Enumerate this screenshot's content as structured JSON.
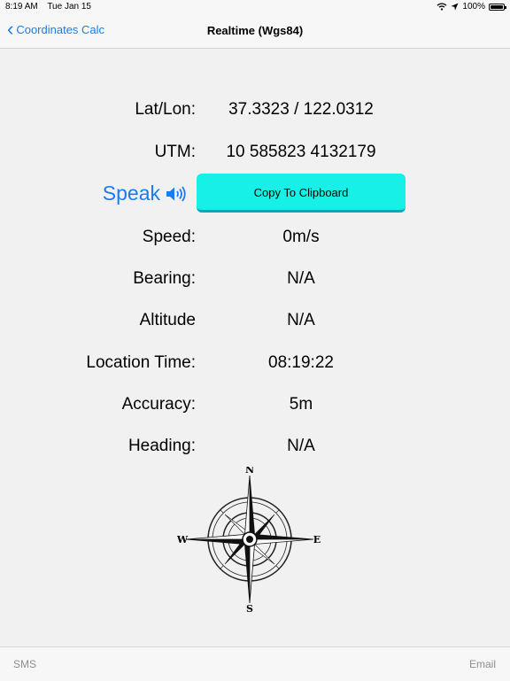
{
  "status_bar": {
    "time": "8:19 AM",
    "date": "Tue Jan 15",
    "battery": "100%",
    "battery_level": 1.0,
    "icons": [
      "wifi-icon",
      "location-arrow-icon",
      "battery-icon"
    ]
  },
  "nav": {
    "back_label": "Coordinates Calc",
    "title": "Realtime (Wgs84)"
  },
  "rows": {
    "latlon": {
      "label": "Lat/Lon:",
      "value": "37.3323 / 122.0312"
    },
    "utm": {
      "label": "UTM:",
      "value": "10  585823 4132179"
    },
    "speed": {
      "label": "Speed:",
      "value": "0m/s"
    },
    "bearing": {
      "label": "Bearing:",
      "value": "N/A"
    },
    "altitude": {
      "label": "Altitude",
      "value": "N/A"
    },
    "location_time": {
      "label": "Location Time:",
      "value": "08:19:22"
    },
    "accuracy": {
      "label": "Accuracy:",
      "value": "5m"
    },
    "heading": {
      "label": "Heading:",
      "value": "N/A"
    }
  },
  "actions": {
    "speak_label": "Speak",
    "copy_label": "Copy To Clipboard"
  },
  "compass": {
    "n": "N",
    "e": "E",
    "s": "S",
    "w": "W"
  },
  "bottom": {
    "sms_label": "SMS",
    "email_label": "Email"
  },
  "colors": {
    "accent": "#1a7cf0",
    "copy_button": "#17f0e6",
    "background": "#f1f1f1"
  }
}
